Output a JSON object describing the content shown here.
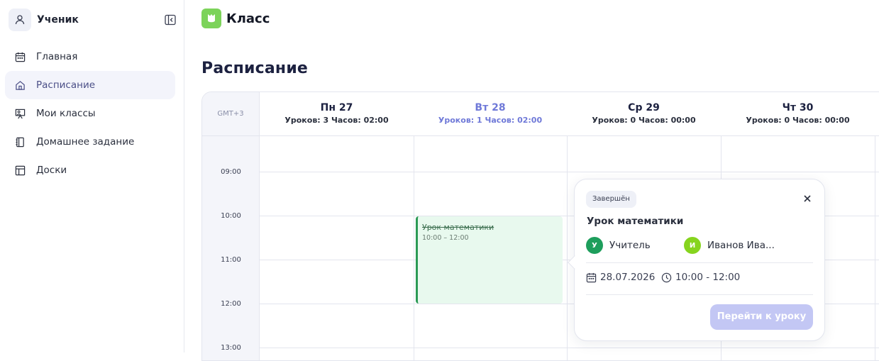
{
  "sidebar": {
    "user_name": "Ученик",
    "items": [
      {
        "label": "Главная",
        "icon": "calendar-icon"
      },
      {
        "label": "Расписание",
        "icon": "home-icon",
        "active": true
      },
      {
        "label": "Мои классы",
        "icon": "presentation-icon"
      },
      {
        "label": "Домашнее задание",
        "icon": "notebook-icon"
      },
      {
        "label": "Доски",
        "icon": "board-icon"
      }
    ]
  },
  "header": {
    "app_name": "Класс",
    "page_title": "Расписание"
  },
  "calendar": {
    "timezone": "GMT+3",
    "days": [
      {
        "name": "Пн 27",
        "stats": "Уроков: 3 Часов: 02:00"
      },
      {
        "name": "Вт 28",
        "stats": "Уроков: 1 Часов: 02:00",
        "today": true
      },
      {
        "name": "Ср 29",
        "stats": "Уроков: 0 Часов: 00:00"
      },
      {
        "name": "Чт 30",
        "stats": "Уроков: 0 Часов: 00:00"
      }
    ],
    "times": [
      "09:00",
      "10:00",
      "11:00",
      "12:00",
      "13:00"
    ],
    "event": {
      "title": "Урок математики",
      "time": "10:00 – 12:00"
    }
  },
  "popup": {
    "status": "Завершён",
    "title": "Урок математики",
    "teacher": {
      "initial": "У",
      "name": "Учитель",
      "color": "#1e9e5c"
    },
    "student": {
      "initial": "И",
      "name": "Иванов Ива...",
      "color": "#86d41e"
    },
    "date": "28.07.2026",
    "time": "10:00 - 12:00",
    "button": "Перейти к уроку"
  },
  "colors": {
    "accent": "#6f79d8",
    "brand": "#7cd35a",
    "event_border": "#2b9a55"
  }
}
